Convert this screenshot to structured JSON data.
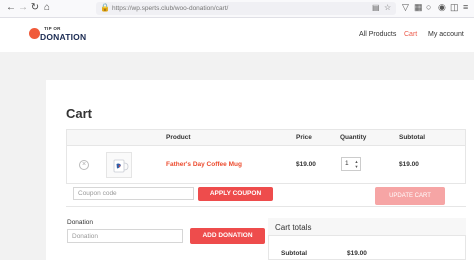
{
  "browser": {
    "url": "https://wp.sperts.club/woo-donation/cart/",
    "icons": {
      "back": "back-arrow-icon",
      "forward": "forward-arrow-icon",
      "reload": "reload-icon",
      "home": "home-icon"
    }
  },
  "site": {
    "logo_top": "TIP OR",
    "logo_main": "DONATION",
    "nav": [
      {
        "label": "All Products"
      },
      {
        "label": "Cart"
      },
      {
        "label": "My account"
      }
    ]
  },
  "cart": {
    "title": "Cart",
    "columns": [
      "Product",
      "Price",
      "Quantity",
      "Subtotal"
    ],
    "items": [
      {
        "name": "Father's Day Coffee Mug",
        "price": "$19.00",
        "quantity": "1",
        "subtotal": "$19.00"
      }
    ],
    "coupon_placeholder": "Coupon code",
    "apply_coupon_label": "APPLY COUPON",
    "update_cart_label": "UPDATE CART"
  },
  "donation": {
    "label": "Donation",
    "placeholder": "Donation",
    "button_label": "ADD DONATION"
  },
  "totals": {
    "title": "Cart totals",
    "subtotal_label": "Subtotal",
    "subtotal_value": "$19.00"
  },
  "colors": {
    "accent": "#ee4c4c",
    "link": "#ec4b2e",
    "brand_navy": "#1a2a52"
  }
}
